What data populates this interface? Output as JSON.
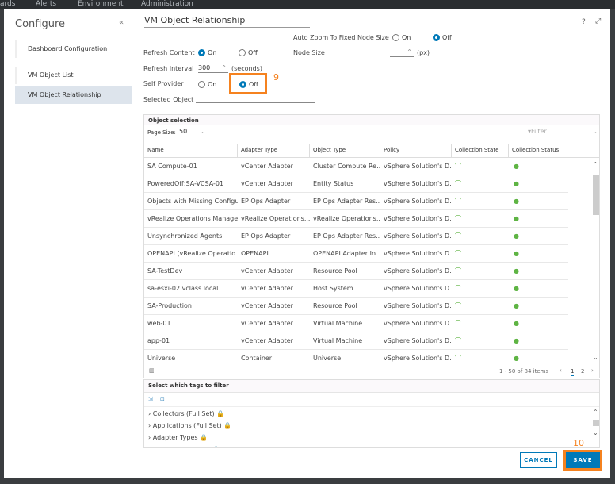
{
  "topnav": [
    "ards",
    "Alerts",
    "Environment",
    "Administration"
  ],
  "sidebar": {
    "title": "Configure",
    "collapse": "«",
    "items": [
      {
        "label": "Dashboard Configuration"
      },
      {
        "label": "VM Object List"
      },
      {
        "label": "VM Object Relationship",
        "active": true
      }
    ]
  },
  "header": {
    "title": "VM Object Relationship",
    "help": "?",
    "expand": "⤢"
  },
  "form": {
    "refresh_content": {
      "label": "Refresh Content",
      "on": "On",
      "off": "Off",
      "selected": "On"
    },
    "refresh_interval": {
      "label": "Refresh Interval",
      "value": "300",
      "unit": "(seconds)"
    },
    "self_provider": {
      "label": "Self Provider",
      "on": "On",
      "off": "Off",
      "selected": "Off"
    },
    "selected_object": {
      "label": "Selected Object",
      "value": ""
    },
    "auto_zoom": {
      "label": "Auto Zoom To Fixed Node Size",
      "on": "On",
      "off": "Off",
      "selected": "Off"
    },
    "node_size": {
      "label": "Node Size",
      "value": "",
      "unit": "(px)"
    }
  },
  "annotations": {
    "step9": "9",
    "step10": "10",
    "color": "#f5821f"
  },
  "object_selection": {
    "title": "Object selection",
    "page_size_label": "Page Size:",
    "page_size": "50",
    "filter_placeholder": "Filter",
    "columns": [
      "Name",
      "Adapter Type",
      "Object Type",
      "Policy",
      "Collection State",
      "Collection Status"
    ],
    "rows": [
      [
        "SA Compute-01",
        "vCenter Adapter",
        "Cluster Compute Re...",
        "vSphere Solution's D..."
      ],
      [
        "PoweredOff:SA-VCSA-01",
        "vCenter Adapter",
        "Entity Status",
        "vSphere Solution's D..."
      ],
      [
        "Objects with Missing Configu...",
        "EP Ops Adapter",
        "EP Ops Adapter Res...",
        "vSphere Solution's D..."
      ],
      [
        "vRealize Operations Manage...",
        "vRealize Operations...",
        "vRealize Operations...",
        "vSphere Solution's D..."
      ],
      [
        "Unsynchronized Agents",
        "EP Ops Adapter",
        "EP Ops Adapter Res...",
        "vSphere Solution's D..."
      ],
      [
        "OPENAPI (vRealize Operatio...",
        "OPENAPI",
        "OPENAPI Adapter In...",
        "vSphere Solution's D..."
      ],
      [
        "SA-TestDev",
        "vCenter Adapter",
        "Resource Pool",
        "vSphere Solution's D..."
      ],
      [
        "sa-esxi-02.vclass.local",
        "vCenter Adapter",
        "Host System",
        "vSphere Solution's D..."
      ],
      [
        "SA-Production",
        "vCenter Adapter",
        "Resource Pool",
        "vSphere Solution's D..."
      ],
      [
        "web-01",
        "vCenter Adapter",
        "Virtual Machine",
        "vSphere Solution's D..."
      ],
      [
        "app-01",
        "vCenter Adapter",
        "Virtual Machine",
        "vSphere Solution's D..."
      ],
      [
        "Universe",
        "Container",
        "Universe",
        "vSphere Solution's D..."
      ]
    ],
    "pagination": {
      "summary": "1 - 50 of 84 items",
      "pages": [
        "1",
        "2"
      ],
      "current": "1"
    }
  },
  "tags": {
    "title": "Select which tags to filter",
    "items": [
      "Collectors (Full Set)",
      "Applications (Full Set)",
      "Adapter Types",
      "Adapter Instances"
    ]
  },
  "buttons": {
    "cancel": "CANCEL",
    "save": "SAVE"
  },
  "colors": {
    "accent": "#0079b8",
    "status_green": "#5eb443"
  }
}
